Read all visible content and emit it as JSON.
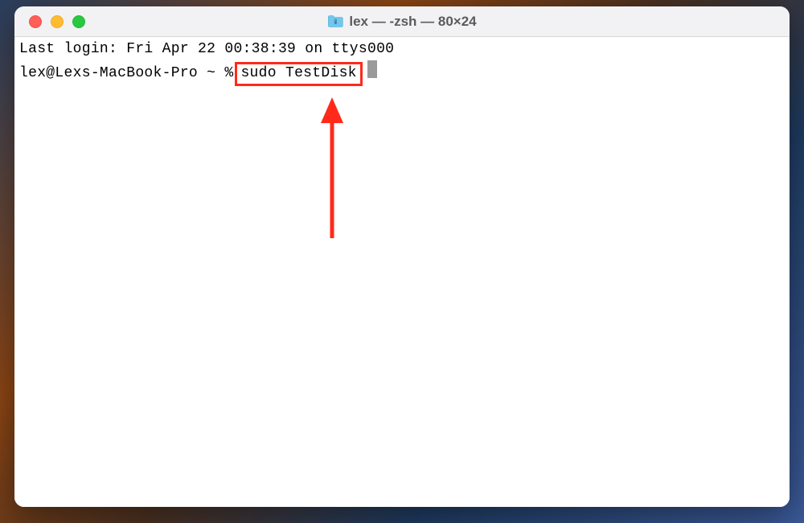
{
  "window": {
    "title": "lex — -zsh — 80×24"
  },
  "terminal": {
    "last_login_line": "Last login: Fri Apr 22 00:38:39 on ttys000",
    "prompt": "lex@Lexs-MacBook-Pro ~ %",
    "command": "sudo TestDisk"
  },
  "annotation": {
    "highlight_color": "#ff2a1a"
  }
}
